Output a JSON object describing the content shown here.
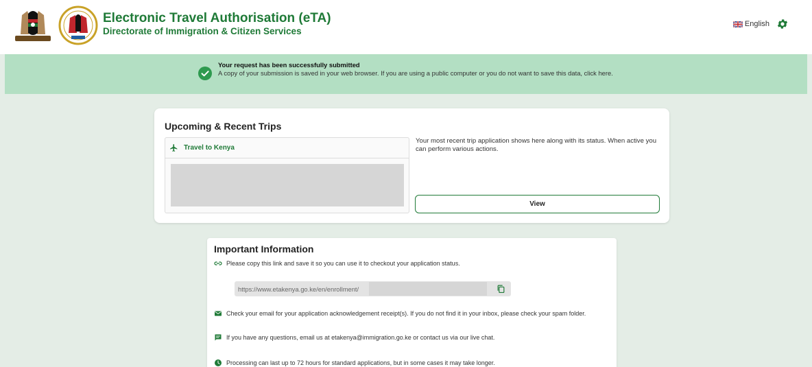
{
  "header": {
    "title": "Electronic Travel Authorisation (eTA)",
    "subtitle": "Directorate of Immigration & Citizen Services",
    "logos": [
      "kenya-coat-of-arms-logo",
      "immigration-seal-logo"
    ],
    "language_label": "English",
    "icons": {
      "flag": "uk-flag-icon",
      "settings": "gear-icon"
    }
  },
  "banner": {
    "title": "Your request has been successfully submitted",
    "body": "A copy of your submission is saved in your web browser. If you are using a public computer or you do not want to save this data, click here.",
    "icon": "check-circle-icon",
    "background": "#b3dfc3"
  },
  "trips": {
    "heading": "Upcoming & Recent Trips",
    "trip_label": "Travel to Kenya",
    "trip_icon": "airplane-icon",
    "description": "Your most recent trip application shows here along with its status. When active you can perform various actions.",
    "view_button": "View"
  },
  "info": {
    "heading": "Important Information",
    "copy_link_text": "Please copy this link and save it so you can use it to checkout your application status.",
    "link_url": "https://www.etakenya.go.ke/en/enrollment/",
    "email_text": "Check your email for your application acknowledgement receipt(s). If you do not find it in your inbox, please check your spam folder.",
    "contact_text": "If you have any questions, email us at etakenya@immigration.go.ke or contact us via our live chat.",
    "processing_text": "Processing can last up to 72 hours for standard applications, but in some cases it may take longer.",
    "icons": [
      "link-icon",
      "envelope-icon",
      "chat-icon",
      "clock-icon",
      "copy-icon"
    ]
  },
  "colors": {
    "brand_green": "#1f7a37",
    "page_background": "#e4ede6"
  }
}
